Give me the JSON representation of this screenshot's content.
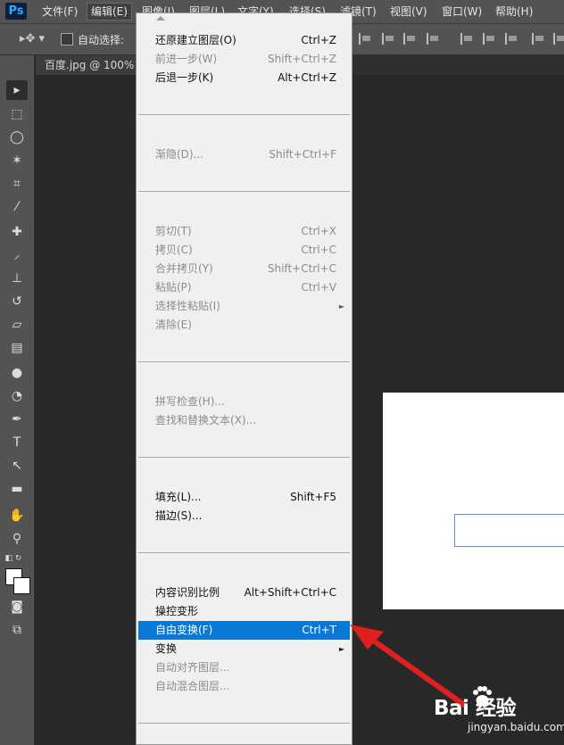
{
  "menubar": {
    "logo": "Ps",
    "items": [
      {
        "label": "文件(F)"
      },
      {
        "label": "编辑(E)"
      },
      {
        "label": "图像(I)"
      },
      {
        "label": "图层(L)"
      },
      {
        "label": "文字(Y)"
      },
      {
        "label": "选择(S)"
      },
      {
        "label": "滤镜(T)"
      },
      {
        "label": "视图(V)"
      },
      {
        "label": "窗口(W)"
      },
      {
        "label": "帮助(H)"
      }
    ]
  },
  "options_bar": {
    "auto_select_label": "自动选择:"
  },
  "document": {
    "tab_title": "百度.jpg @ 100% ("
  },
  "edit_menu": {
    "items": [
      {
        "label": "还原建立图层(O)",
        "shortcut": "Ctrl+Z",
        "enabled": true
      },
      {
        "label": "前进一步(W)",
        "shortcut": "Shift+Ctrl+Z",
        "enabled": false
      },
      {
        "label": "后退一步(K)",
        "shortcut": "Alt+Ctrl+Z",
        "enabled": true
      },
      {
        "label": "渐隐(D)...",
        "shortcut": "Shift+Ctrl+F",
        "enabled": false
      },
      {
        "label": "剪切(T)",
        "shortcut": "Ctrl+X",
        "enabled": false
      },
      {
        "label": "拷贝(C)",
        "shortcut": "Ctrl+C",
        "enabled": false
      },
      {
        "label": "合并拷贝(Y)",
        "shortcut": "Shift+Ctrl+C",
        "enabled": false
      },
      {
        "label": "粘贴(P)",
        "shortcut": "Ctrl+V",
        "enabled": false
      },
      {
        "label": "选择性粘贴(I)",
        "shortcut": "",
        "enabled": false,
        "submenu": true
      },
      {
        "label": "清除(E)",
        "shortcut": "",
        "enabled": false
      },
      {
        "label": "拼写检查(H)...",
        "shortcut": "",
        "enabled": false
      },
      {
        "label": "查找和替换文本(X)...",
        "shortcut": "",
        "enabled": false
      },
      {
        "label": "填充(L)...",
        "shortcut": "Shift+F5",
        "enabled": true
      },
      {
        "label": "描边(S)...",
        "shortcut": "",
        "enabled": true
      },
      {
        "label": "内容识别比例",
        "shortcut": "Alt+Shift+Ctrl+C",
        "enabled": true
      },
      {
        "label": "操控变形",
        "shortcut": "",
        "enabled": true
      },
      {
        "label": "自由变换(F)",
        "shortcut": "Ctrl+T",
        "enabled": true,
        "highlighted": true
      },
      {
        "label": "变换",
        "shortcut": "",
        "enabled": true,
        "submenu": true
      },
      {
        "label": "自动对齐图层...",
        "shortcut": "",
        "enabled": false
      },
      {
        "label": "自动混合图层...",
        "shortcut": "",
        "enabled": false
      }
    ],
    "submenu_arrow": "►"
  },
  "watermark": {
    "brand": "Bai  经验",
    "url": "jingyan.baidu.com"
  },
  "colors": {
    "highlight": "#0a78d7",
    "arrow": "#e0201e",
    "menubar": "#535353"
  }
}
